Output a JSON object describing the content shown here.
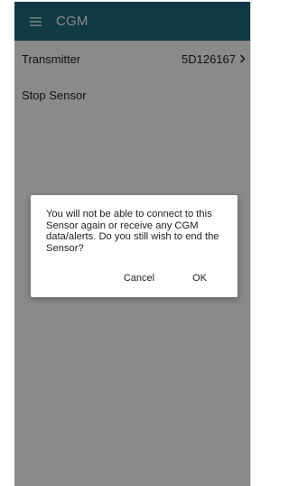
{
  "app_bar": {
    "title": "CGM",
    "menu_icon": "hamburger-menu-icon",
    "background": "#1c6a7d"
  },
  "settings": {
    "transmitter_label": "Transmitter",
    "transmitter_value": "5D126167",
    "stop_sensor_label": "Stop Sensor"
  },
  "dialog": {
    "message": "You will not be able to connect to this Sensor again or receive any CGM data/alerts. Do you still wish to end the Sensor?",
    "cancel_label": "Cancel",
    "ok_label": "OK"
  }
}
